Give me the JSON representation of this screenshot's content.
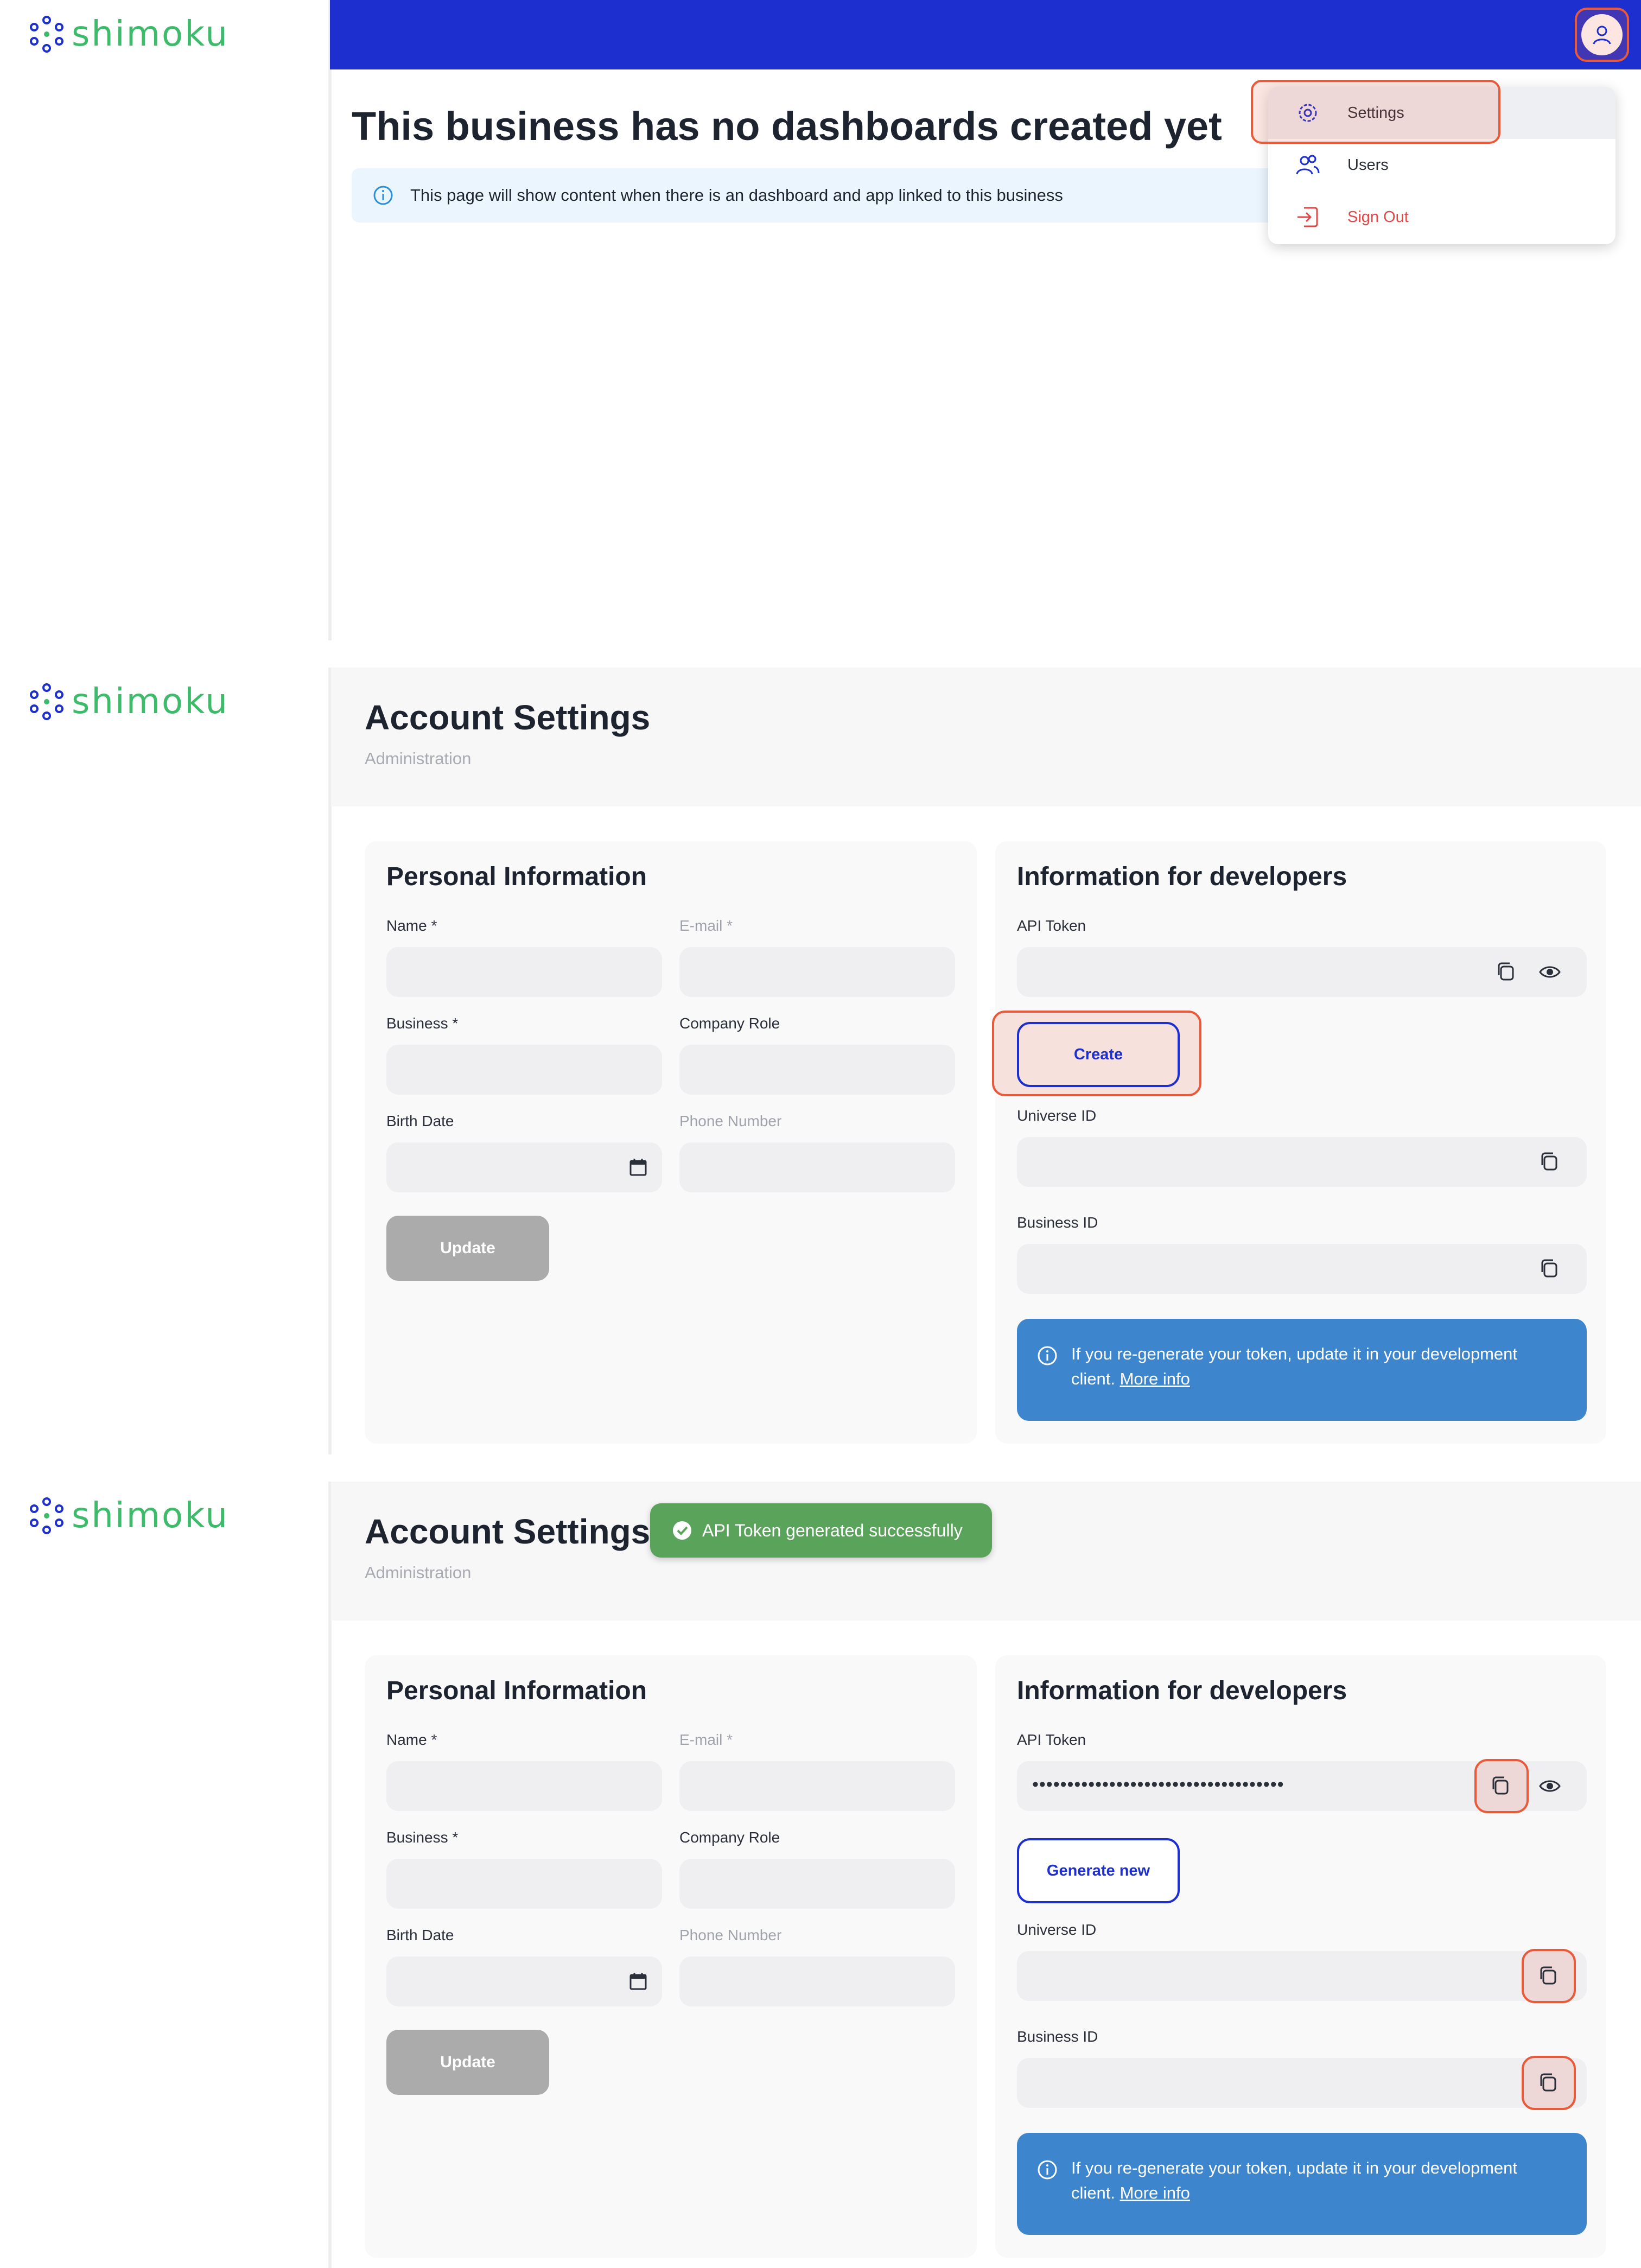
{
  "brand": {
    "name": "shimoku",
    "color": "#3dbb6b",
    "accent": "#1d2fcf"
  },
  "home": {
    "empty_title": "This business has no dashboards created yet",
    "info_text": "This page will show content when there is an dashboard and app linked to this business",
    "menu": {
      "settings": "Settings",
      "users": "Users",
      "sign_out": "Sign Out"
    }
  },
  "account": {
    "title": "Account Settings",
    "subtitle": "Administration",
    "personal": {
      "title": "Personal Information",
      "name_label": "Name *",
      "email_label": "E-mail *",
      "business_label": "Business *",
      "company_role_label": "Company Role",
      "birth_date_label": "Birth Date",
      "phone_label": "Phone Number",
      "update_label": "Update"
    },
    "developers": {
      "title": "Information for developers",
      "api_token_label": "API Token",
      "create_label": "Create",
      "generate_new_label": "Generate new",
      "universe_id_label": "Universe ID",
      "business_id_label": "Business ID",
      "note_text": "If you re-generate your token, update it in your development client.",
      "note_link": "More info",
      "token_masked": "••••••••••••••••••••••••••••••••••••"
    },
    "toast": "API Token generated successfully"
  }
}
